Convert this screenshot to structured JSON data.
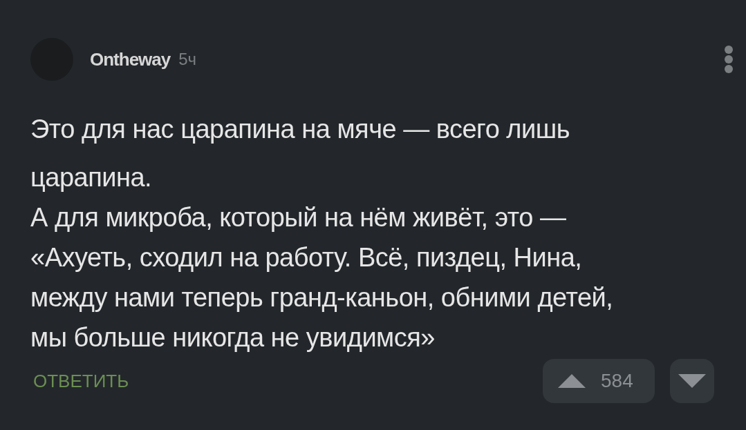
{
  "comment": {
    "author": "Ontheway",
    "time": "5ч",
    "lines": [
      "Это для нас царапина на мяче — всего лишь",
      "царапина.",
      "А для микроба, который на нём живёт, это —",
      "«Ахуеть, сходил на работу. Всё, пиздец, Нина,",
      "между нами теперь гранд-каньон, обними детей,",
      "мы больше никогда не увидимся»"
    ],
    "reply": "ОТВЕТИТЬ",
    "rating": "584"
  }
}
